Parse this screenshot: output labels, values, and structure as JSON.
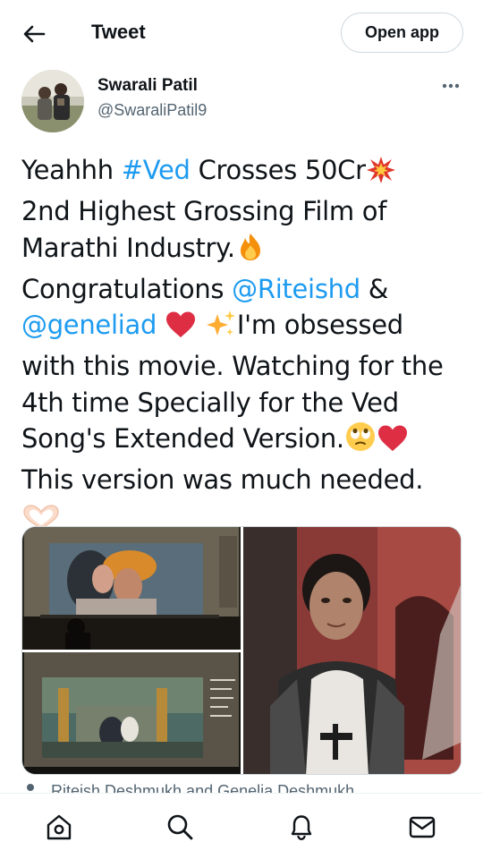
{
  "header": {
    "title": "Tweet",
    "open_app_label": "Open app"
  },
  "author": {
    "name": "Swarali Patil",
    "handle": "@SwaraliPatil9"
  },
  "tweet": {
    "line1_a": "Yeahhh ",
    "hashtag": "#Ved",
    "line1_b": " Crosses 50Cr",
    "line2": "2nd Highest Grossing Film of",
    "line3": "Marathi Industry.",
    "line4_a": "Congratulations ",
    "mention1": "@Riteishd",
    "line4_b": " &",
    "mention2": "@geneliad",
    "line5_b": "I'm obsessed",
    "line6": "with this movie. Watching for the",
    "line7": "4th time Specially for the Ved",
    "line8": "Song's Extended Version.",
    "line9": "This version was much needed."
  },
  "context": {
    "text": "Riteish Deshmukh and Genelia Deshmukh"
  },
  "nav": {
    "items": [
      "home-icon",
      "search-icon",
      "notifications-icon",
      "messages-icon"
    ]
  },
  "colors": {
    "link": "#1d9bf0",
    "text": "#0f1419",
    "secondary": "#536471",
    "border": "#cfd9de"
  }
}
